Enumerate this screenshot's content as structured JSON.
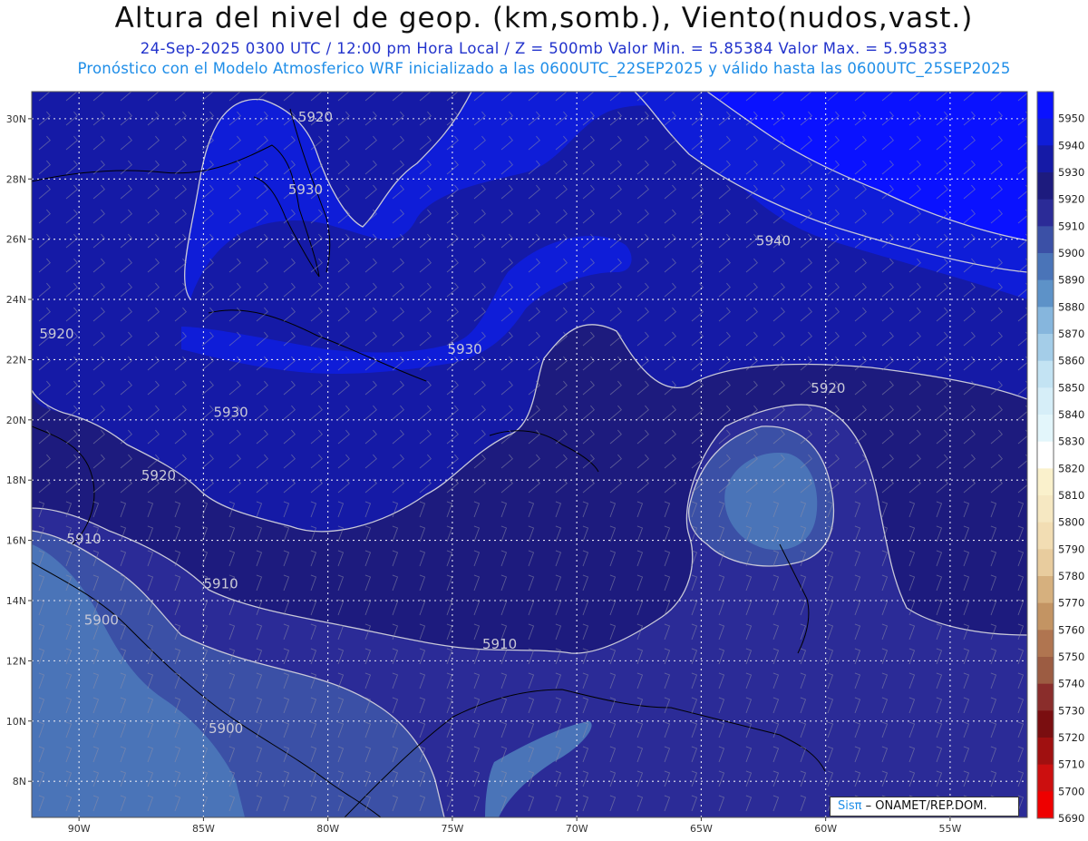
{
  "header": {
    "title": "Altura del nivel de geop. (km,somb.), Viento(nudos,vast.)",
    "subtitle1": "24-Sep-2025  0300 UTC / 12:00 pm Hora Local / Z = 500mb     Valor Min. = 5.85384  Valor Max. = 5.95833",
    "subtitle2": "Pronóstico con el Modelo Atmosferico WRF inicializado a las 0600UTC_22SEP2025 y válido hasta las  0600UTC_25SEP2025"
  },
  "axes": {
    "lat_ticks": [
      "30N",
      "28N",
      "26N",
      "24N",
      "22N",
      "20N",
      "18N",
      "16N",
      "14N",
      "12N",
      "10N",
      "8N"
    ],
    "lon_ticks": [
      "90W",
      "85W",
      "80W",
      "75W",
      "70W",
      "65W",
      "60W",
      "55W"
    ]
  },
  "contour_labels": [
    {
      "text": "5920",
      "lon": -80.5,
      "lat": 29.9
    },
    {
      "text": "5930",
      "lon": -80.9,
      "lat": 27.5
    },
    {
      "text": "5940",
      "lon": -62.1,
      "lat": 25.8
    },
    {
      "text": "5920",
      "lon": -90.9,
      "lat": 22.7
    },
    {
      "text": "5930",
      "lon": -74.5,
      "lat": 22.2
    },
    {
      "text": "5920",
      "lon": -59.9,
      "lat": 20.9
    },
    {
      "text": "5930",
      "lon": -83.9,
      "lat": 20.1
    },
    {
      "text": "5920",
      "lon": -86.8,
      "lat": 18.0
    },
    {
      "text": "5910",
      "lon": -89.8,
      "lat": 15.9
    },
    {
      "text": "5910",
      "lon": -84.3,
      "lat": 14.4
    },
    {
      "text": "5900",
      "lon": -89.1,
      "lat": 13.2
    },
    {
      "text": "5910",
      "lon": -73.1,
      "lat": 12.4
    },
    {
      "text": "5900",
      "lon": -84.1,
      "lat": 9.6
    }
  ],
  "colorbar": {
    "levels": [
      "5950",
      "5940",
      "5930",
      "5920",
      "5910",
      "5900",
      "5890",
      "5880",
      "5870",
      "5860",
      "5850",
      "5840",
      "5830",
      "5820",
      "5810",
      "5800",
      "5790",
      "5780",
      "5770",
      "5760",
      "5750",
      "5740",
      "5730",
      "5720",
      "5710",
      "5700",
      "5690"
    ],
    "colors": [
      "#0a12ff",
      "#0f1dd8",
      "#151aa6",
      "#1d1b7e",
      "#2b2b97",
      "#3b50a6",
      "#4a74b8",
      "#5d92c8",
      "#86b6dd",
      "#a4cde8",
      "#c3e3f3",
      "#d6eef8",
      "#e3f6fb",
      "#ffffff",
      "#faf1cc",
      "#f6e8c2",
      "#f2ddb3",
      "#e8cc9e",
      "#d6b07e",
      "#c39463",
      "#b07550",
      "#9c5c42",
      "#8a2d2b",
      "#7a0e10",
      "#a01010",
      "#cc0f0f",
      "#ee0000"
    ]
  },
  "map_colors": {
    "c5940": "#0f1dd8",
    "c5930": "#151aa6",
    "c5920": "#1d1b7e",
    "c5910": "#2b2b97",
    "c5900": "#3b50a6",
    "c5890": "#4a74b8",
    "c5880": "#5d92c8"
  },
  "footer": {
    "logo": "Sis",
    "logo_pi": "π",
    "credit": " – ONAMET/REP.DOM."
  }
}
